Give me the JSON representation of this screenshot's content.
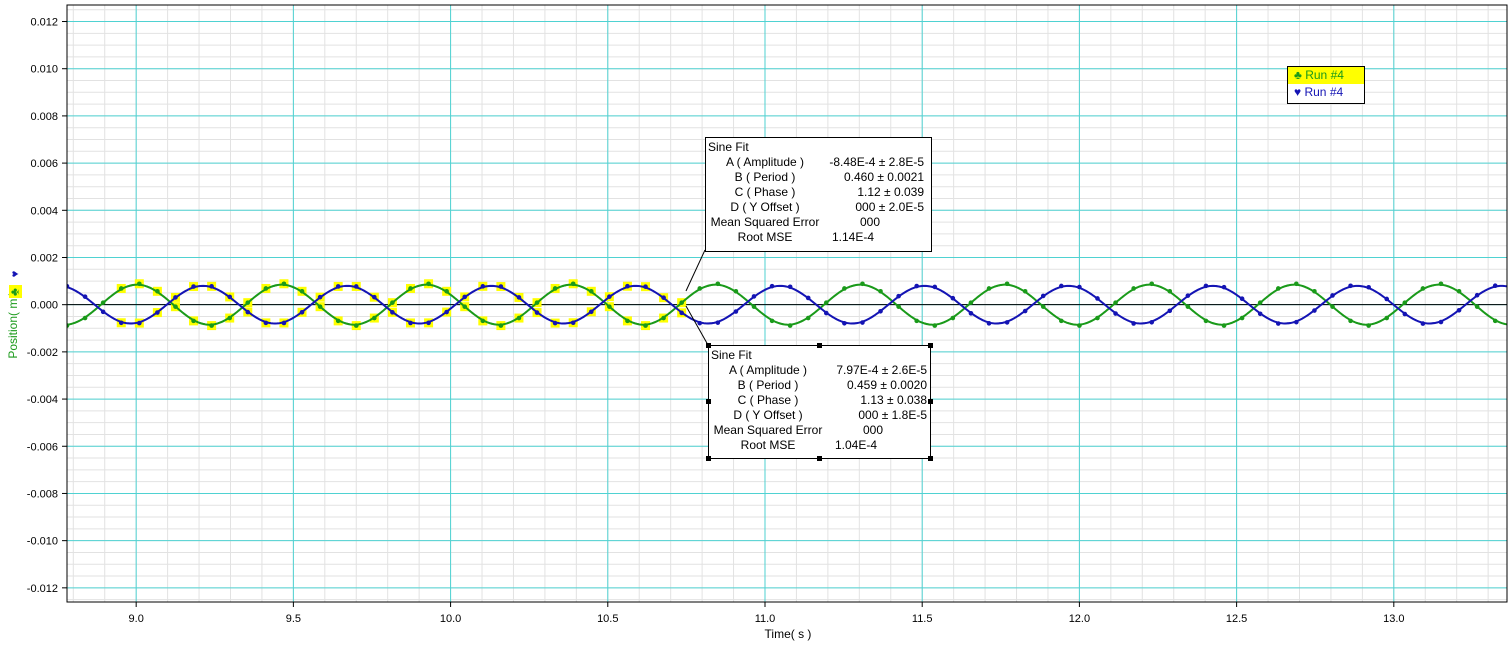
{
  "chart_data": {
    "type": "line",
    "title": "",
    "xlabel": "Time( s )",
    "ylabel": "Position( m )",
    "xlim": [
      8.78,
      13.36
    ],
    "ylim": [
      -0.0126,
      0.0127
    ],
    "x_ticks": [
      "9.0",
      "9.5",
      "10.0",
      "10.5",
      "11.0",
      "11.5",
      "12.0",
      "12.5",
      "13.0"
    ],
    "y_ticks": [
      "0.012",
      "0.010",
      "0.008",
      "0.006",
      "0.004",
      "0.002",
      "0.000",
      "-0.002",
      "-0.004",
      "-0.006",
      "-0.008",
      "-0.010",
      "-0.012"
    ],
    "grid": true,
    "legend_placement": "top-right",
    "series": [
      {
        "name": "Run #4",
        "marker": "club",
        "color": "#1a9a1a",
        "fit": {
          "amplitude": -0.000848,
          "period": 0.46,
          "phase": 1.12,
          "offset": 0.0
        },
        "x_start": 8.78,
        "x_end": 13.36,
        "sample_step": 0.0575,
        "highlight_range": [
          8.95,
          10.75
        ]
      },
      {
        "name": "Run #4",
        "marker": "heart",
        "color": "#1414b4",
        "fit": {
          "amplitude": 0.000797,
          "period": 0.459,
          "phase": 1.13,
          "offset": 0.0
        },
        "x_start": 8.78,
        "x_end": 13.36,
        "sample_step": 0.0575,
        "highlight_range": [
          8.95,
          10.75
        ]
      }
    ],
    "annotations": [
      {
        "title": "Sine Fit",
        "rows": [
          {
            "label": "A ( Amplitude )",
            "value": "-8.48E-4 ± 2.8E-5"
          },
          {
            "label": "B ( Period )",
            "value": "0.460 ± 0.0021"
          },
          {
            "label": "C ( Phase )",
            "value": "1.12 ±  0.039"
          },
          {
            "label": "D ( Y Offset )",
            "value": "000 ± 2.0E-5"
          },
          {
            "label": "Mean Squared Error",
            "value": "000"
          },
          {
            "label": "Root MSE",
            "value": "1.14E-4"
          }
        ]
      },
      {
        "title": "Sine Fit",
        "rows": [
          {
            "label": "A ( Amplitude )",
            "value": "7.97E-4 ± 2.6E-5"
          },
          {
            "label": "B ( Period )",
            "value": "0.459 ± 0.0020"
          },
          {
            "label": "C ( Phase )",
            "value": "1.13 ±  0.038"
          },
          {
            "label": "D ( Y Offset )",
            "value": "000 ± 1.8E-5"
          },
          {
            "label": "Mean Squared Error",
            "value": "000"
          },
          {
            "label": "Root MSE",
            "value": "1.04E-4"
          }
        ]
      }
    ]
  },
  "legend": {
    "items": [
      {
        "icon": "club-icon",
        "label": "Run #4",
        "color": "#1a9a1a",
        "selected": true
      },
      {
        "icon": "heart-icon",
        "label": "Run #4",
        "color": "#1414b4",
        "selected": false
      }
    ]
  },
  "colors": {
    "grid_major": "#4fd2d2",
    "grid_minor": "#e2e2e2",
    "highlight": "#ffff00"
  }
}
